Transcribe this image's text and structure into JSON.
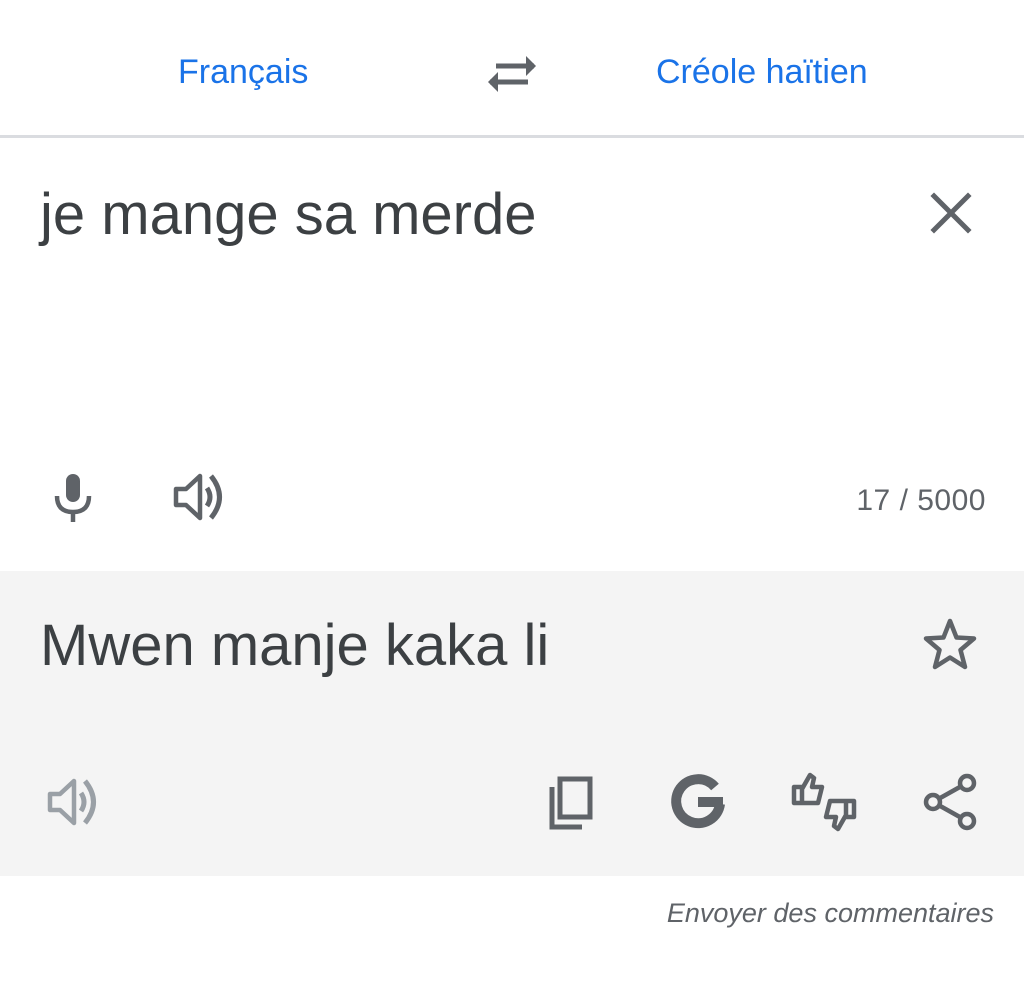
{
  "languages": {
    "source": "Français",
    "target": "Créole haïtien"
  },
  "input": {
    "text": "je mange sa merde",
    "char_count": "17 / 5000"
  },
  "result": {
    "text": "Mwen manje kaka li"
  },
  "footer": {
    "feedback_label": "Envoyer des commentaires"
  },
  "icons": {
    "swap": "swap-horizontal-icon",
    "clear": "close-icon",
    "mic": "microphone-icon",
    "speak_source": "volume-icon",
    "star": "star-outline-icon",
    "speak_result": "volume-icon",
    "copy": "copy-icon",
    "google": "google-g-icon",
    "rate": "thumbs-up-down-icon",
    "share": "share-icon"
  },
  "colors": {
    "accent": "#1a73e8",
    "text": "#3c4043",
    "icon": "#5f6368",
    "icon_disabled": "#9aa0a6",
    "result_bg": "#f4f4f4",
    "divider": "#dadce0"
  }
}
